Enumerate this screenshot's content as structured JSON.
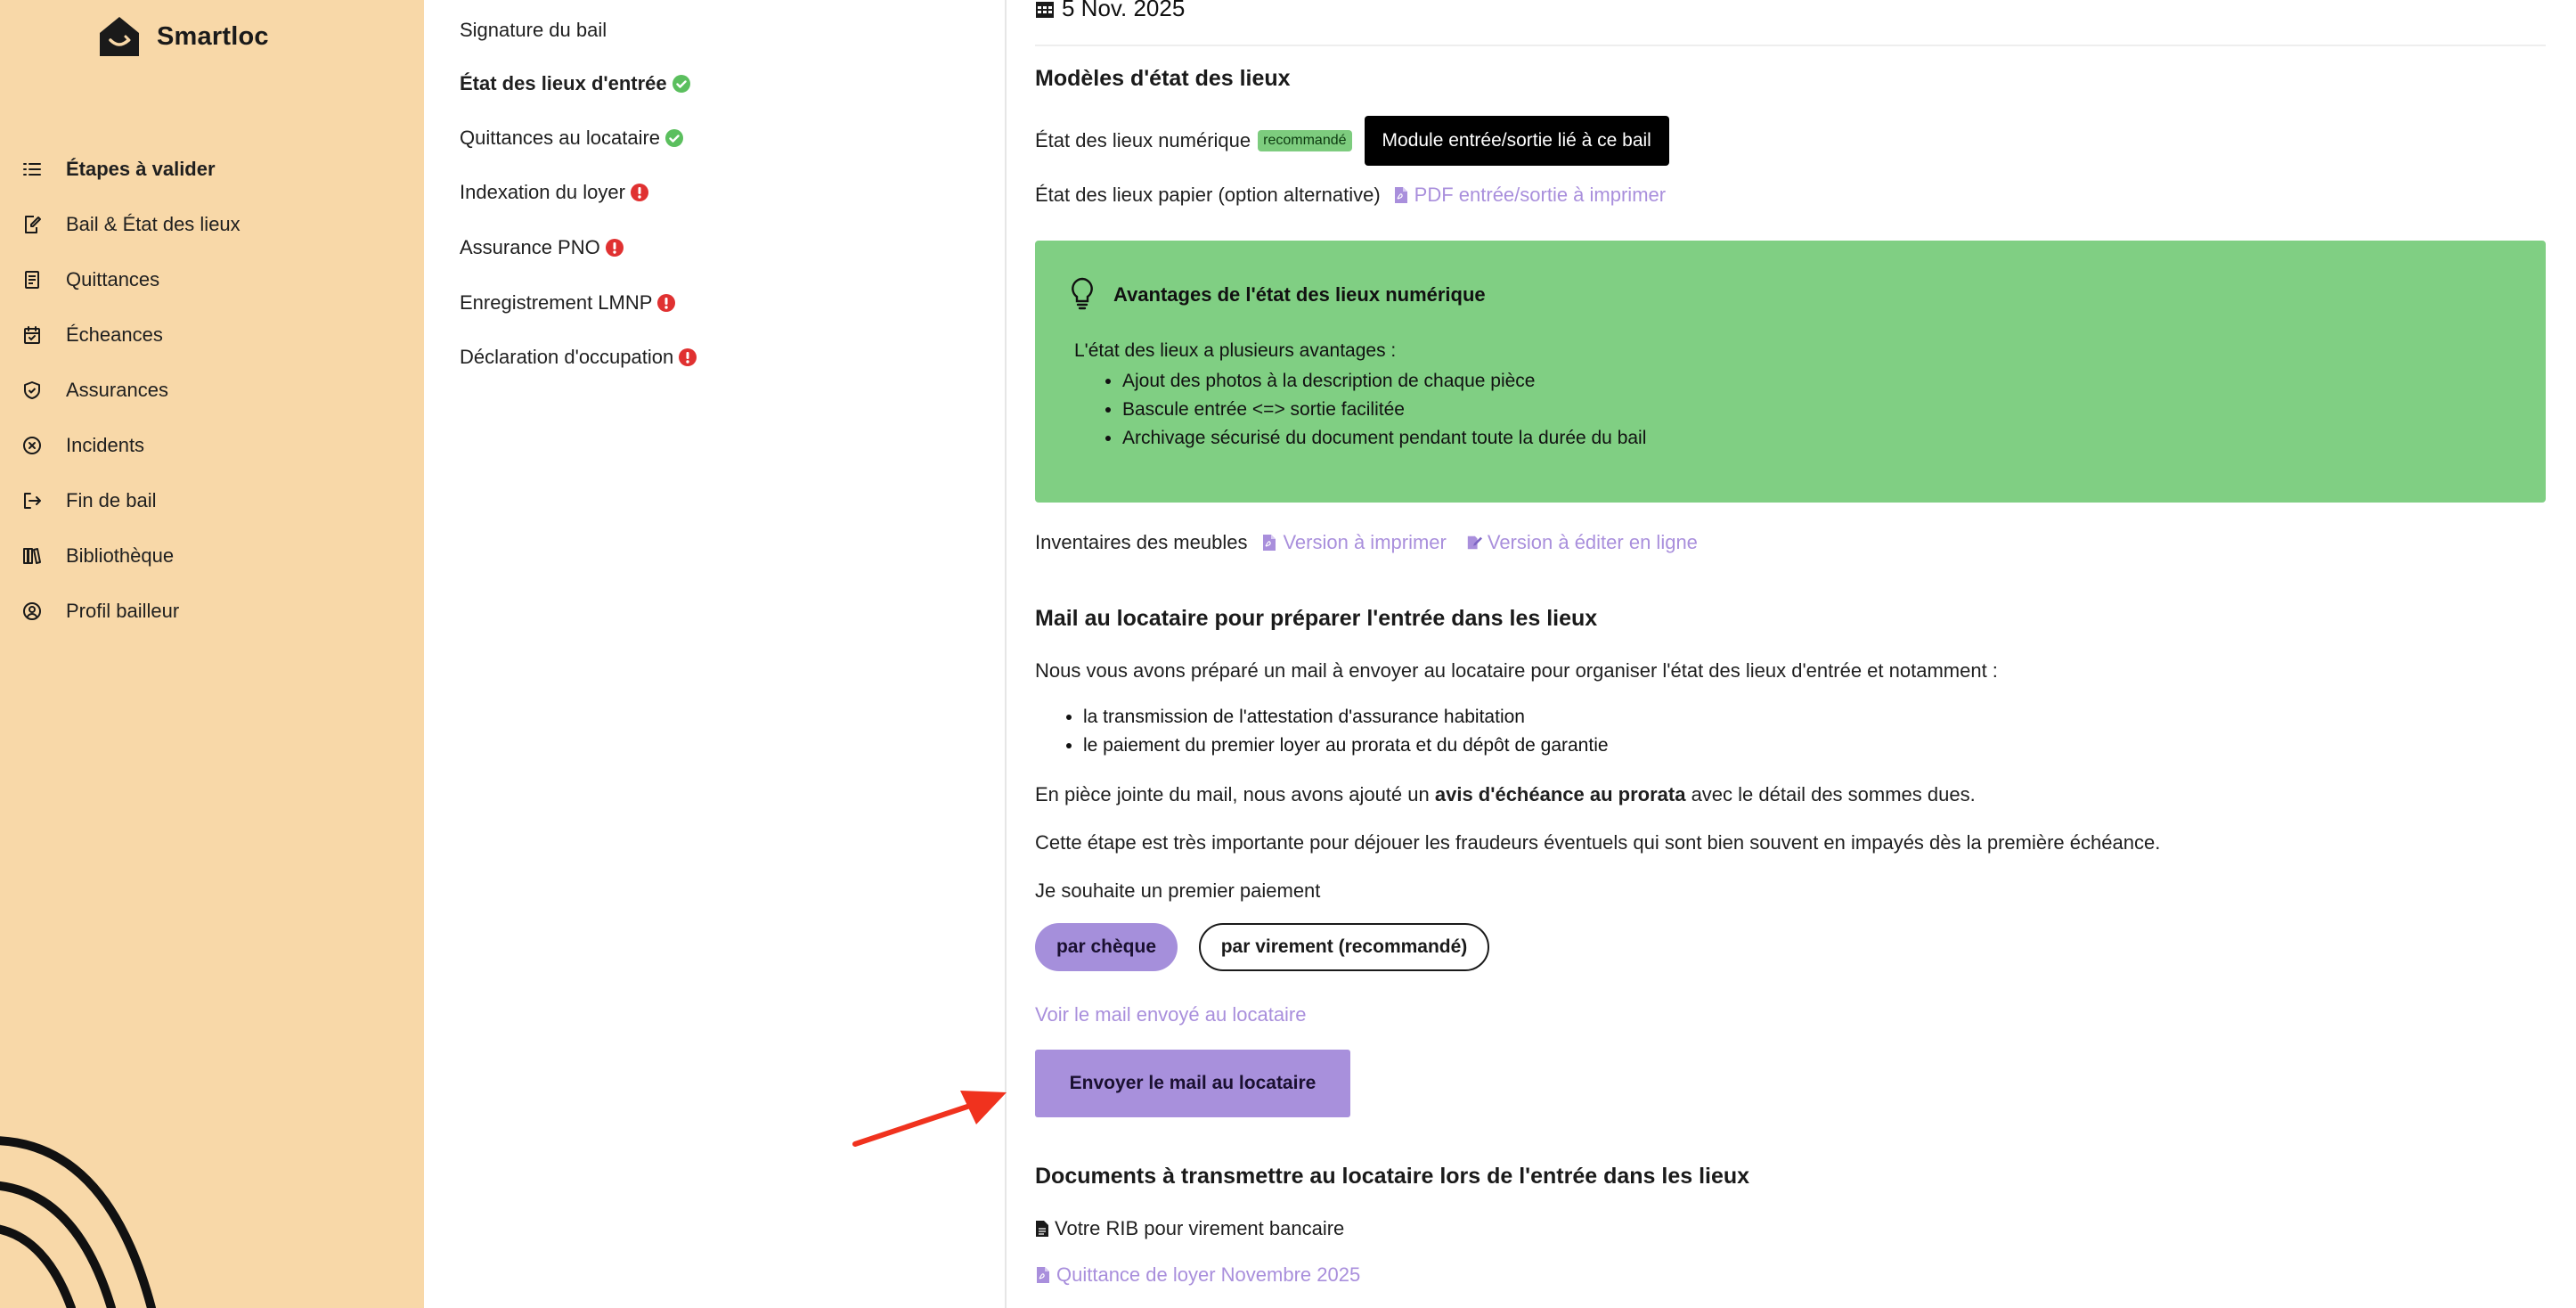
{
  "brand": {
    "name": "Smartloc"
  },
  "sidebar": {
    "items": [
      {
        "label": "Étapes à valider",
        "icon": "checklist-icon",
        "active": true
      },
      {
        "label": "Bail & État des lieux",
        "icon": "edit-document-icon"
      },
      {
        "label": "Quittances",
        "icon": "receipt-icon"
      },
      {
        "label": "Écheances",
        "icon": "calendar-check-icon"
      },
      {
        "label": "Assurances",
        "icon": "shield-check-icon"
      },
      {
        "label": "Incidents",
        "icon": "circle-x-icon"
      },
      {
        "label": "Fin de bail",
        "icon": "exit-icon"
      },
      {
        "label": "Bibliothèque",
        "icon": "books-icon"
      },
      {
        "label": "Profil bailleur",
        "icon": "user-circle-icon"
      }
    ]
  },
  "steps": [
    {
      "label": "Signature du bail",
      "status": "none"
    },
    {
      "label": "État des lieux d'entrée",
      "status": "done",
      "active": true
    },
    {
      "label": "Quittances au locataire",
      "status": "done"
    },
    {
      "label": "Indexation du loyer",
      "status": "alert"
    },
    {
      "label": "Assurance PNO",
      "status": "alert"
    },
    {
      "label": "Enregistrement LMNP",
      "status": "alert"
    },
    {
      "label": "Déclaration d'occupation",
      "status": "alert"
    }
  ],
  "colors": {
    "sidebar_bg": "#f8d8a8",
    "accent_purple": "#a890dc",
    "success_green": "#7dcc7e",
    "alert_red": "#e03131",
    "link_purple": "#a98fdc"
  },
  "main": {
    "date": "5 Nov. 2025",
    "models": {
      "heading": "Modèles d'état des lieux",
      "digital_label": "État des lieux numérique",
      "digital_badge": "recommandé",
      "digital_button": "Module entrée/sortie lié à ce bail",
      "paper_label": "État des lieux papier (option alternative)",
      "paper_link": "PDF entrée/sortie à imprimer"
    },
    "advantages": {
      "title": "Avantages de l'état des lieux numérique",
      "intro": "L'état des lieux a plusieurs avantages :",
      "items": [
        "Ajout des photos à la description de chaque pièce",
        "Bascule entrée <=> sortie facilitée",
        "Archivage sécurisé du document pendant toute la durée du bail"
      ]
    },
    "inventory": {
      "label": "Inventaires des meubles",
      "print_link": "Version à imprimer",
      "edit_link": "Version à éditer en ligne"
    },
    "mail": {
      "heading": "Mail au locataire pour préparer l'entrée dans les lieux",
      "intro": "Nous vous avons préparé un mail à envoyer au locataire pour organiser l'état des lieux d'entrée et notamment :",
      "items": [
        "la transmission de l'attestation d'assurance habitation",
        "le paiement du premier loyer au prorata et du dépôt de garantie"
      ],
      "attach_pre": "En pièce jointe du mail, nous avons ajouté un ",
      "attach_bold": "avis d'échéance au prorata",
      "attach_post": " avec le détail des sommes dues.",
      "important": "Cette étape est très importante pour déjouer les fraudeurs éventuels qui sont bien souvent en impayés dès la première échéance.",
      "payment_prompt": "Je souhaite un premier paiement",
      "option_cheque": "par chèque",
      "option_virement": "par virement (recommandé)",
      "view_link": "Voir le mail envoyé au locataire",
      "send_button": "Envoyer le mail au locataire"
    },
    "documents": {
      "heading": "Documents à transmettre au locataire lors de l'entrée dans les lieux",
      "rib": "Votre RIB pour virement bancaire",
      "quittance_link": "Quittance de loyer Novembre 2025"
    }
  }
}
